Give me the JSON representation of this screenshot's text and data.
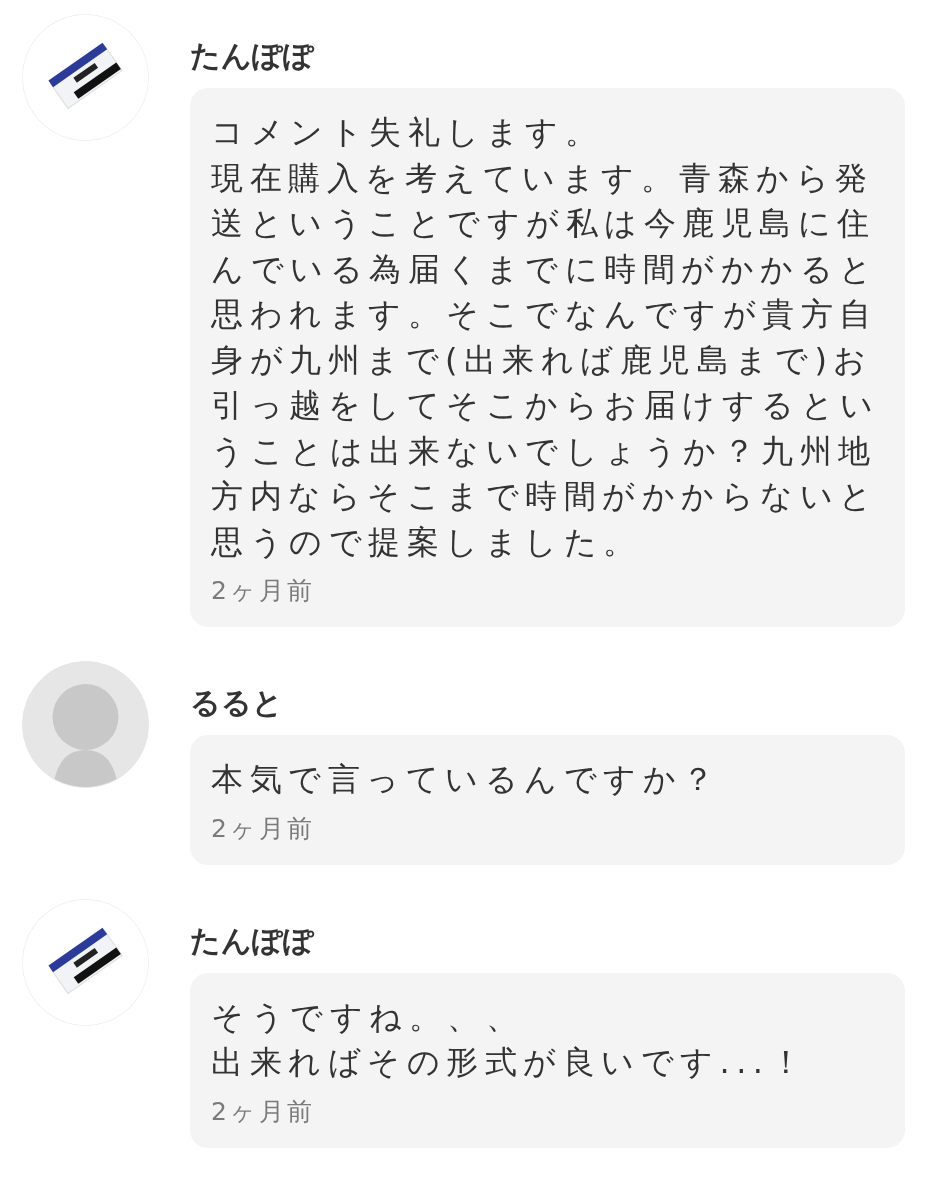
{
  "comments": [
    {
      "avatar": {
        "kind": "picture"
      },
      "author": "たんぽぽ",
      "paragraphs": [
        "コメント失礼します。",
        "現在購入を考えています。青森から発送ということですが私は今鹿児島に住んでいる為届くまでに時間がかかると思われます。そこでなんですが貴方自身が九州まで(出来れば鹿児島まで)お引っ越をしてそこからお届けするということは出来ないでしょうか？九州地方内ならそこまで時間がかからないと思うので提案しました。"
      ],
      "time": "2ヶ月前"
    },
    {
      "avatar": {
        "kind": "default"
      },
      "author": "るると",
      "paragraphs": [
        "本気で言っているんですか？"
      ],
      "time": "2ヶ月前"
    },
    {
      "avatar": {
        "kind": "picture"
      },
      "author": "たんぽぽ",
      "paragraphs": [
        "そうですね。、、",
        "出来ればその形式が良いです...！"
      ],
      "time": "2ヶ月前"
    }
  ]
}
